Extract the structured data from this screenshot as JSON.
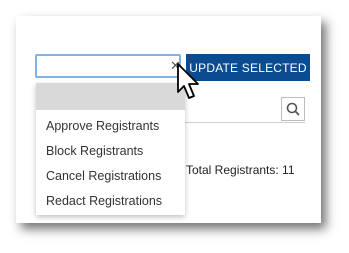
{
  "toolbar": {
    "update_label": "UPDATE SELECTED"
  },
  "dropdown": {
    "options": [
      "Approve Registrants",
      "Block Registrants",
      "Cancel Registrations",
      "Redact Registrations"
    ]
  },
  "summary": {
    "total_label": "Total Registrants: 11"
  },
  "icons": {
    "clear": "close-icon",
    "search": "search-icon",
    "cursor": "mouse-pointer-icon"
  },
  "colors": {
    "primary_button": "#0a4c8f",
    "select_focus_border": "#7fb3e6"
  }
}
